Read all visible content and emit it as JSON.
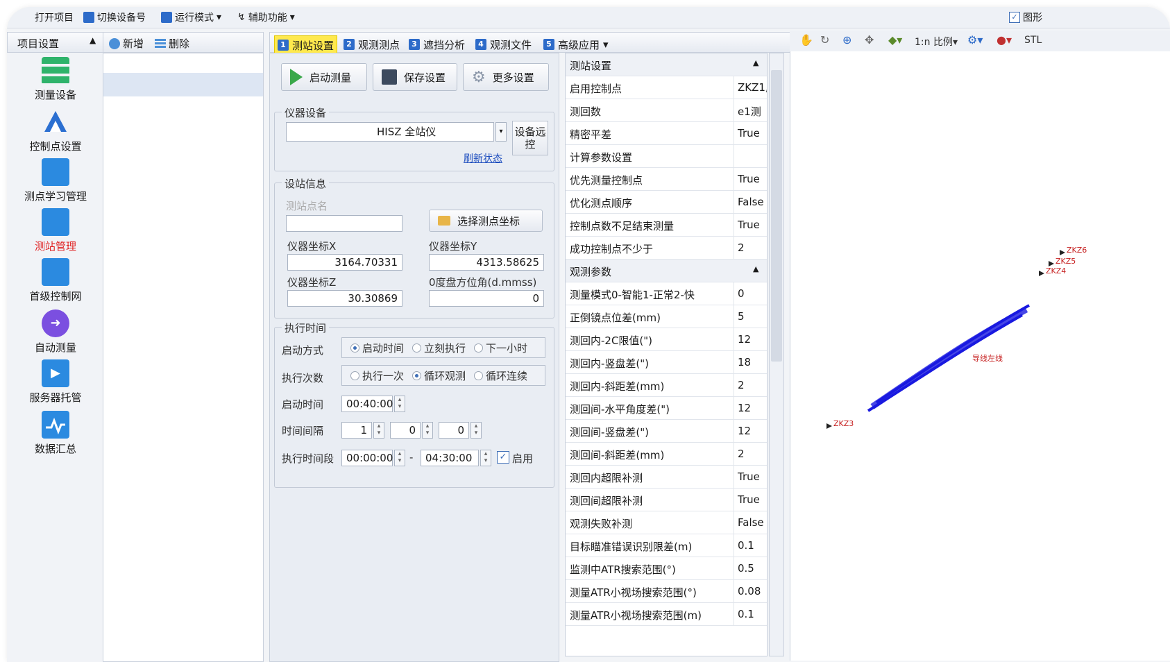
{
  "menu": {
    "items": [
      "打开项目",
      "切换设备号",
      "运行模式",
      "辅助功能"
    ],
    "right_checkbox": "图形"
  },
  "left_panel": {
    "header": "项目设置",
    "items": [
      {
        "label": "测量设备",
        "icon": "server-stack-icon",
        "color": "#2fb36b"
      },
      {
        "label": "控制点设置",
        "icon": "triangle-network-icon",
        "color": "#2b6fd1"
      },
      {
        "label": "测点学习管理",
        "icon": "dot-grid-icon",
        "color": "#2b8ae0"
      },
      {
        "label": "测站管理",
        "icon": "dot-grid-icon",
        "color": "#2b8ae0",
        "active": true
      },
      {
        "label": "首级控制网",
        "icon": "network-map-icon",
        "color": "#2b8ae0"
      },
      {
        "label": "自动测量",
        "icon": "auto-measure-icon",
        "color": "#7b4fe0"
      },
      {
        "label": "服务器托管",
        "icon": "monitor-play-icon",
        "color": "#2b8ae0"
      },
      {
        "label": "数据汇总",
        "icon": "chart-line-icon",
        "color": "#2b8ae0"
      }
    ]
  },
  "list_toolbar": {
    "add": "新增",
    "delete": "删除"
  },
  "tabs": [
    {
      "num": "1",
      "label": "测站设置",
      "active": true
    },
    {
      "num": "2",
      "label": "观测测点"
    },
    {
      "num": "3",
      "label": "遮挡分析"
    },
    {
      "num": "4",
      "label": "观测文件"
    },
    {
      "num": "5",
      "label": "高级应用"
    }
  ],
  "actions": {
    "start": "启动测量",
    "save": "保存设置",
    "more": "更多设置"
  },
  "device": {
    "group": "仪器设备",
    "selected": "HISZ 全站仪",
    "refresh": "刷新状态",
    "remote": "设备远控"
  },
  "station": {
    "group": "设站信息",
    "name_label": "测站点名",
    "select_btn": "选择测点坐标",
    "x_label": "仪器坐标X",
    "x_value": "3164.70331",
    "y_label": "仪器坐标Y",
    "y_value": "4313.58625",
    "z_label": "仪器坐标Z",
    "z_value": "30.30869",
    "azi_label": "0度盘方位角(d.mmss)",
    "azi_value": "0"
  },
  "exec": {
    "group": "执行时间",
    "mode_label": "启动方式",
    "mode_opts": [
      "启动时间",
      "立刻执行",
      "下一小时"
    ],
    "count_label": "执行次数",
    "count_opts": [
      "执行一次",
      "循环观测",
      "循环连续"
    ],
    "start_label": "启动时间",
    "start_value": "00:40:00",
    "interval_label": "时间间隔",
    "interval_values": [
      "1",
      "0",
      "0"
    ],
    "range_label": "执行时间段",
    "range_from": "00:00:00",
    "range_sep": "-",
    "range_to": "04:30:00",
    "enable_label": "启用"
  },
  "props": [
    {
      "k": "测站设置",
      "v": "",
      "cat": true
    },
    {
      "k": "启用控制点",
      "v": "ZKZ1,"
    },
    {
      "k": "测回数",
      "v": "e1测"
    },
    {
      "k": "精密平差",
      "v": "True"
    },
    {
      "k": "计算参数设置",
      "v": ""
    },
    {
      "k": "优先测量控制点",
      "v": "True"
    },
    {
      "k": "优化测点顺序",
      "v": "False"
    },
    {
      "k": "控制点数不足结束测量",
      "v": "True"
    },
    {
      "k": "成功控制点不少于",
      "v": "2"
    },
    {
      "k": "观测参数",
      "v": "",
      "cat": true
    },
    {
      "k": "测量模式0-智能1-正常2-快",
      "v": "0"
    },
    {
      "k": "正倒镜点位差(mm)",
      "v": "5"
    },
    {
      "k": "测回内-2C限值(\")",
      "v": "12"
    },
    {
      "k": "测回内-竖盘差(\")",
      "v": "18"
    },
    {
      "k": "测回内-斜距差(mm)",
      "v": "2"
    },
    {
      "k": "测回间-水平角度差(\")",
      "v": "12"
    },
    {
      "k": "测回间-竖盘差(\")",
      "v": "12"
    },
    {
      "k": "测回间-斜距差(mm)",
      "v": "2"
    },
    {
      "k": "测回内超限补测",
      "v": "True"
    },
    {
      "k": "测回间超限补测",
      "v": "True"
    },
    {
      "k": "观测失败补测",
      "v": "False"
    },
    {
      "k": "目标瞄准错误识别限差(m)",
      "v": "0.1"
    },
    {
      "k": "监测中ATR搜索范围(°)",
      "v": "0.5"
    },
    {
      "k": "测量ATR小视场搜索范围(°)",
      "v": "0.08"
    },
    {
      "k": "测量ATR小视场搜索范围(m)",
      "v": "0.1"
    }
  ],
  "view_toolbar": {
    "ratio": "比例",
    "stl": "STL"
  },
  "map_labels": [
    "ZKZ6",
    "ZKZ5",
    "ZKZ4",
    "ZKZ3",
    "导线左线"
  ]
}
